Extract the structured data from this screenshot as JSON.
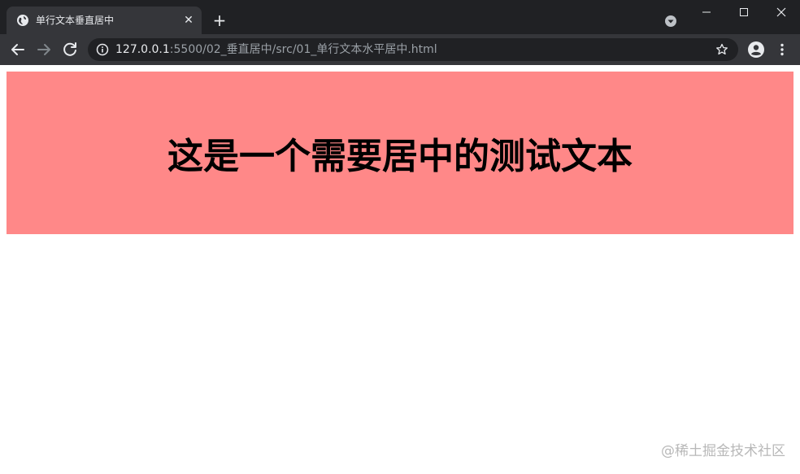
{
  "browser": {
    "tab": {
      "title": "单行文本垂直居中",
      "favicon": "globe-icon",
      "close_glyph": "✕"
    },
    "new_tab_glyph": "+",
    "address_bar": {
      "host": "127.0.0.1",
      "path": ":5500/02_垂直居中/src/01_单行文本水平居中.html"
    }
  },
  "page": {
    "heading": "这是一个需要居中的测试文本",
    "box_color": "#ff8888"
  },
  "watermark": "@稀土掘金技术社区",
  "colors": {
    "tabstrip": "#202124",
    "toolbar": "#35363a",
    "text_light": "#e8eaed",
    "text_dim": "#9aa0a6"
  }
}
